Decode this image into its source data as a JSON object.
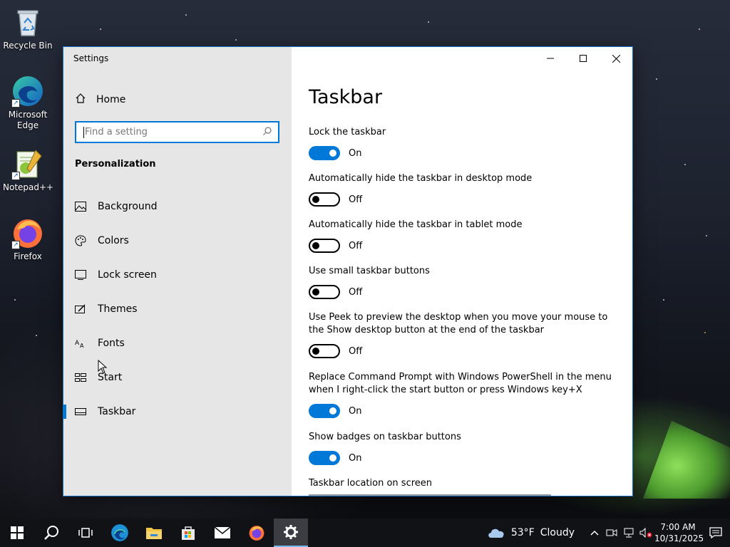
{
  "desktop": {
    "icons": [
      {
        "label": "Recycle Bin"
      },
      {
        "label": "Microsoft Edge"
      },
      {
        "label": "Notepad++"
      },
      {
        "label": "Firefox"
      }
    ]
  },
  "window": {
    "title": "Settings",
    "accent": "#0078d7"
  },
  "sidebar": {
    "home": "Home",
    "search_placeholder": "Find a setting",
    "section": "Personalization",
    "items": [
      {
        "label": "Background",
        "icon": "picture-icon"
      },
      {
        "label": "Colors",
        "icon": "palette-icon"
      },
      {
        "label": "Lock screen",
        "icon": "lock-screen-icon"
      },
      {
        "label": "Themes",
        "icon": "themes-icon"
      },
      {
        "label": "Fonts",
        "icon": "fonts-icon"
      },
      {
        "label": "Start",
        "icon": "start-icon"
      },
      {
        "label": "Taskbar",
        "icon": "taskbar-icon"
      }
    ],
    "active_item": "Taskbar"
  },
  "main": {
    "title": "Taskbar",
    "settings": [
      {
        "label": "Lock the taskbar",
        "state": "On"
      },
      {
        "label": "Automatically hide the taskbar in desktop mode",
        "state": "Off"
      },
      {
        "label": "Automatically hide the taskbar in tablet mode",
        "state": "Off"
      },
      {
        "label": "Use small taskbar buttons",
        "state": "Off"
      },
      {
        "label": "Use Peek to preview the desktop when you move your mouse to the Show desktop button at the end of the taskbar",
        "state": "Off"
      },
      {
        "label": "Replace Command Prompt with Windows PowerShell in the menu when I right-click the start button or press Windows key+X",
        "state": "On"
      },
      {
        "label": "Show badges on taskbar buttons",
        "state": "On"
      }
    ],
    "location_label": "Taskbar location on screen"
  },
  "taskbar": {
    "weather": {
      "temp": "53°F",
      "condition": "Cloudy"
    },
    "time": "7:00 AM",
    "date": "10/31/2025"
  }
}
